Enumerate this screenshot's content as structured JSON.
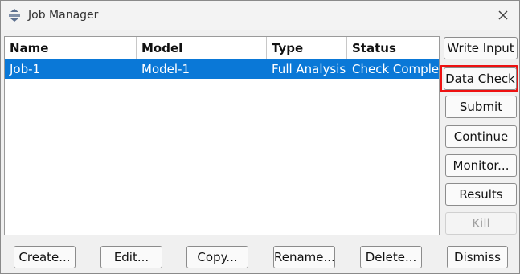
{
  "window": {
    "title": "Job Manager"
  },
  "icons": {
    "app": "app-icon",
    "close": "close-icon"
  },
  "table": {
    "columns": [
      "Name",
      "Model",
      "Type",
      "Status"
    ],
    "rows": [
      {
        "name": "Job-1",
        "model": "Model-1",
        "type": "Full Analysis",
        "status": "Check Complet"
      }
    ]
  },
  "side_buttons": {
    "write_input": "Write Input",
    "data_check": "Data Check",
    "submit": "Submit",
    "continue": "Continue",
    "monitor": "Monitor...",
    "results": "Results",
    "kill": "Kill"
  },
  "bottom_buttons": {
    "create": "Create...",
    "edit": "Edit...",
    "copy": "Copy...",
    "rename": "Rename...",
    "delete": "Delete...",
    "dismiss": "Dismiss"
  },
  "colors": {
    "selection": "#0a78d7",
    "highlight_box": "#ee1111"
  }
}
